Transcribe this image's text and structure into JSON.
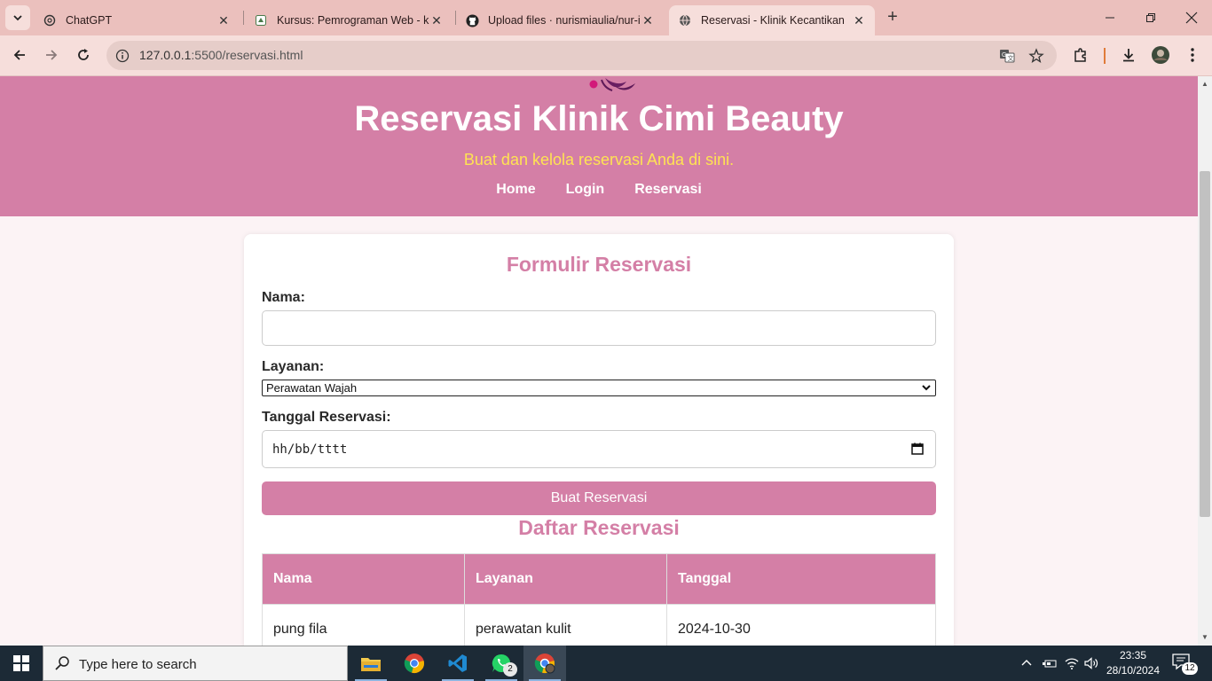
{
  "browser": {
    "tabs": [
      {
        "title": "ChatGPT",
        "icon": "chatgpt-icon"
      },
      {
        "title": "Kursus: Pemrograman Web - ke",
        "icon": "course-icon"
      },
      {
        "title": "Upload files · nurismiaulia/nur-i",
        "icon": "github-icon"
      },
      {
        "title": "Reservasi - Klinik Kecantikan",
        "icon": "globe-icon",
        "active": true
      }
    ],
    "url_host": "127.0.0.1",
    "url_path": ":5500/reservasi.html"
  },
  "header": {
    "title": "Reservasi Klinik Cimi Beauty",
    "subtitle": "Buat dan kelola reservasi Anda di sini.",
    "nav": [
      "Home",
      "Login",
      "Reservasi"
    ]
  },
  "form": {
    "title": "Formulir Reservasi",
    "name_label": "Nama:",
    "name_value": "",
    "service_label": "Layanan:",
    "service_value": "Perawatan Wajah",
    "date_label": "Tanggal Reservasi:",
    "date_placeholder": "hh/bb/tttt",
    "submit_label": "Buat Reservasi"
  },
  "list": {
    "title": "Daftar Reservasi",
    "columns": [
      "Nama",
      "Layanan",
      "Tanggal"
    ],
    "rows": [
      [
        "pung fila",
        "perawatan kulit",
        "2024-10-30"
      ]
    ]
  },
  "taskbar": {
    "search_placeholder": "Type here to search",
    "whatsapp_badge": "2",
    "time": "23:35",
    "date": "28/10/2024",
    "notifications": "12"
  },
  "colors": {
    "brand_pink": "#d47fa6",
    "subtitle_yellow": "#ffe352"
  }
}
